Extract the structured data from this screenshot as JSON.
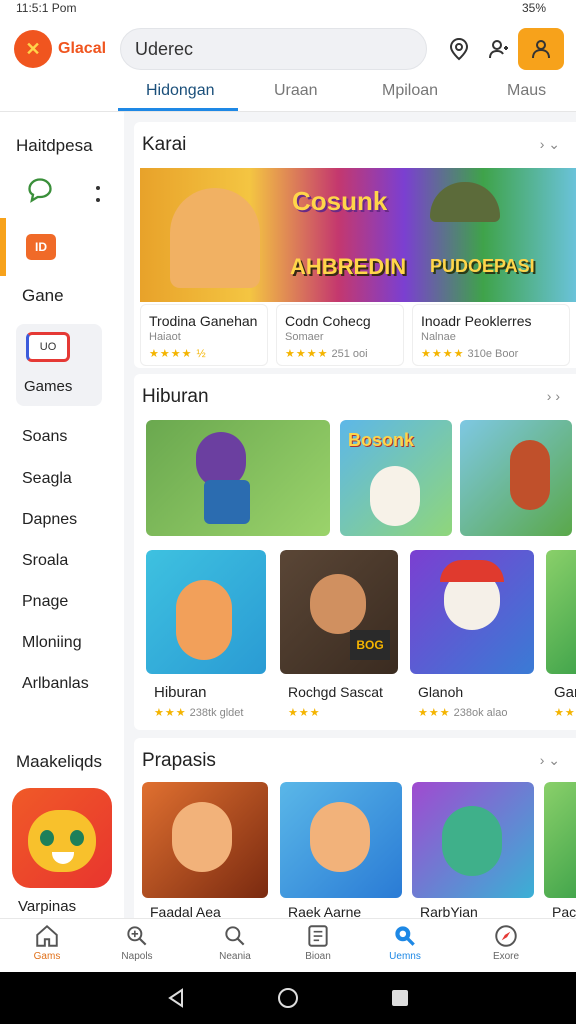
{
  "status_bar": {
    "time": "11:5:1 Pom",
    "battery": "35%"
  },
  "header": {
    "logo_text": "Glacal",
    "search_value": "Uderec"
  },
  "tabs": [
    {
      "label": "Hidongan"
    },
    {
      "label": "Uraan"
    },
    {
      "label": "Mpiloan"
    },
    {
      "label": "Maus"
    }
  ],
  "sidebar": {
    "title": "Haitdpesa",
    "game_label": "Gane",
    "card_label": "Games",
    "items": [
      {
        "label": "Soans"
      },
      {
        "label": "Seagla"
      },
      {
        "label": "Dapnes"
      },
      {
        "label": "Sroala"
      },
      {
        "label": "Pnage"
      },
      {
        "label": "Mloniing"
      },
      {
        "label": "Arlbanlas"
      }
    ],
    "bottom_title": "Maakeliqds",
    "bottom_card_label": "Varpinas"
  },
  "sections": [
    {
      "title": "Karai",
      "cards": [
        {
          "title": "Trodina Ganehan",
          "sub": "Haiaot",
          "stars": "★★★★",
          "rating": "★★★★ ½"
        },
        {
          "title": "Codn Cohecg",
          "sub": "Somaer",
          "stars": "★★★★",
          "rating": "251 ooi"
        },
        {
          "title": "Inoadr Peoklerres",
          "sub": "Nalnae",
          "stars": "★★★★",
          "rating": "310e Boor"
        }
      ],
      "banner_text_1": "Cosunk",
      "banner_text_2": "AHBREDIN",
      "banner_text_3": "PUDOEPASI"
    },
    {
      "title": "Hiburan",
      "row1_texts": [
        "Bosonk"
      ],
      "cards": [
        {
          "title": "Hiburan",
          "stars": "★★★",
          "rating": "238tk gldet"
        },
        {
          "title": "Rochgd Sascat",
          "stars": "★★★",
          "rating": ""
        },
        {
          "title": "Glanoh",
          "stars": "★★★",
          "rating": "238ok alao"
        },
        {
          "title": "Gar",
          "stars": "★★",
          "rating": ""
        }
      ]
    },
    {
      "title": "Prapasis",
      "cards": [
        {
          "title": "Faadal Aea"
        },
        {
          "title": "Raek Aarne"
        },
        {
          "title": "RarbYian"
        },
        {
          "title": "Pac"
        }
      ]
    }
  ],
  "bottom_nav": [
    {
      "label": "Gams",
      "icon": "home-icon"
    },
    {
      "label": "Napols",
      "icon": "gamepad-icon"
    },
    {
      "label": "Neania",
      "icon": "search-icon"
    },
    {
      "label": "Bioan",
      "icon": "news-icon"
    },
    {
      "label": "Uemns",
      "icon": "search-active-icon"
    },
    {
      "label": "Exore",
      "icon": "explore-icon"
    }
  ]
}
